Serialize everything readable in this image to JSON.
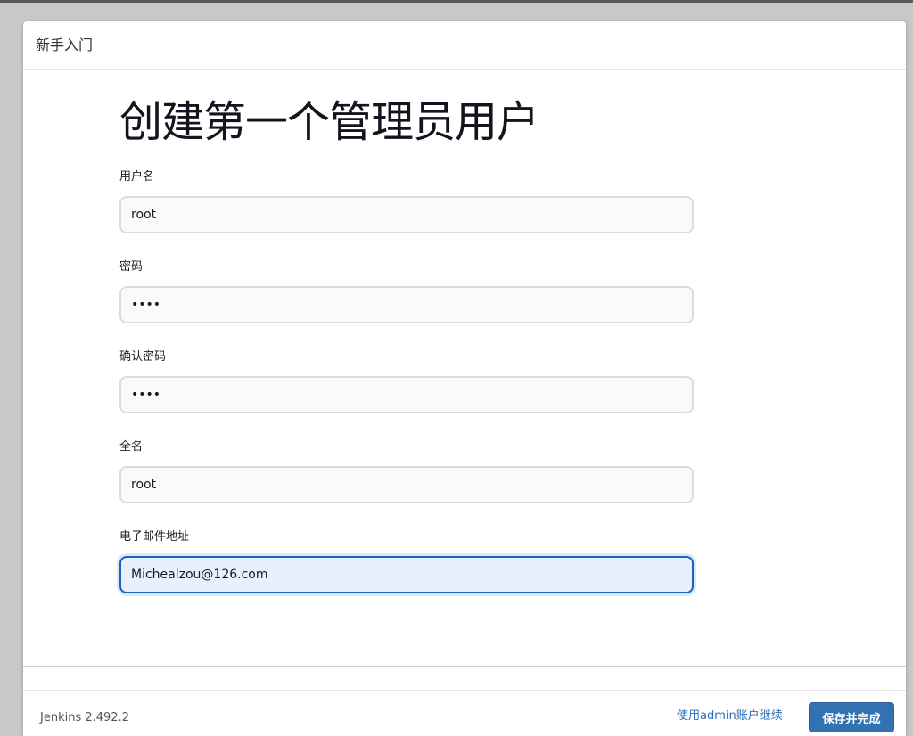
{
  "dialog": {
    "title": "新手入门"
  },
  "page": {
    "title": "创建第一个管理员用户"
  },
  "form": {
    "fields": [
      {
        "label": "用户名",
        "value": "root",
        "type": "text"
      },
      {
        "label": "密码",
        "value": "••••",
        "type": "password"
      },
      {
        "label": "确认密码",
        "value": "••••",
        "type": "password"
      },
      {
        "label": "全名",
        "value": "root",
        "type": "text"
      },
      {
        "label": "电子邮件地址",
        "value": "Michealzou@126.com",
        "type": "email",
        "focused": true
      }
    ]
  },
  "footer": {
    "version": "Jenkins 2.492.2",
    "continue_link": "使用admin账户继续",
    "save_button": "保存并完成"
  },
  "colors": {
    "primary_button": "#3272b3",
    "link": "#2a6db5",
    "focus_border": "#1565c0"
  }
}
